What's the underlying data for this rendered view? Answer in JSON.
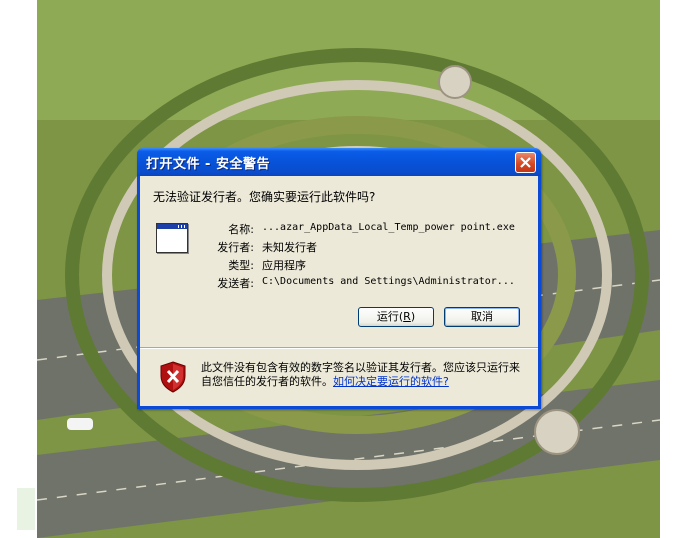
{
  "dialog": {
    "title": "打开文件 - 安全警告",
    "question": "无法验证发行者。您确实要运行此软件吗?",
    "fields": {
      "name_label": "名称:",
      "name_value": "...azar_AppData_Local_Temp_power point.exe",
      "publisher_label": "发行者:",
      "publisher_value": "未知发行者",
      "type_label": "类型:",
      "type_value": "应用程序",
      "from_label": "发送者:",
      "from_value": "C:\\Documents and Settings\\Administrator..."
    },
    "buttons": {
      "run_label": "运行",
      "run_hotkey": "R",
      "cancel_label": "取消"
    },
    "warning": {
      "text": "此文件没有包含有效的数字签名以验证其发行者。您应该只运行来自您信任的发行者的软件。",
      "link": "如何决定要运行的软件?"
    }
  },
  "colors": {
    "titlebar": "#0753d9",
    "dialog_body": "#ece9d8",
    "close_button": "#d2461f",
    "link": "#0033cc"
  }
}
